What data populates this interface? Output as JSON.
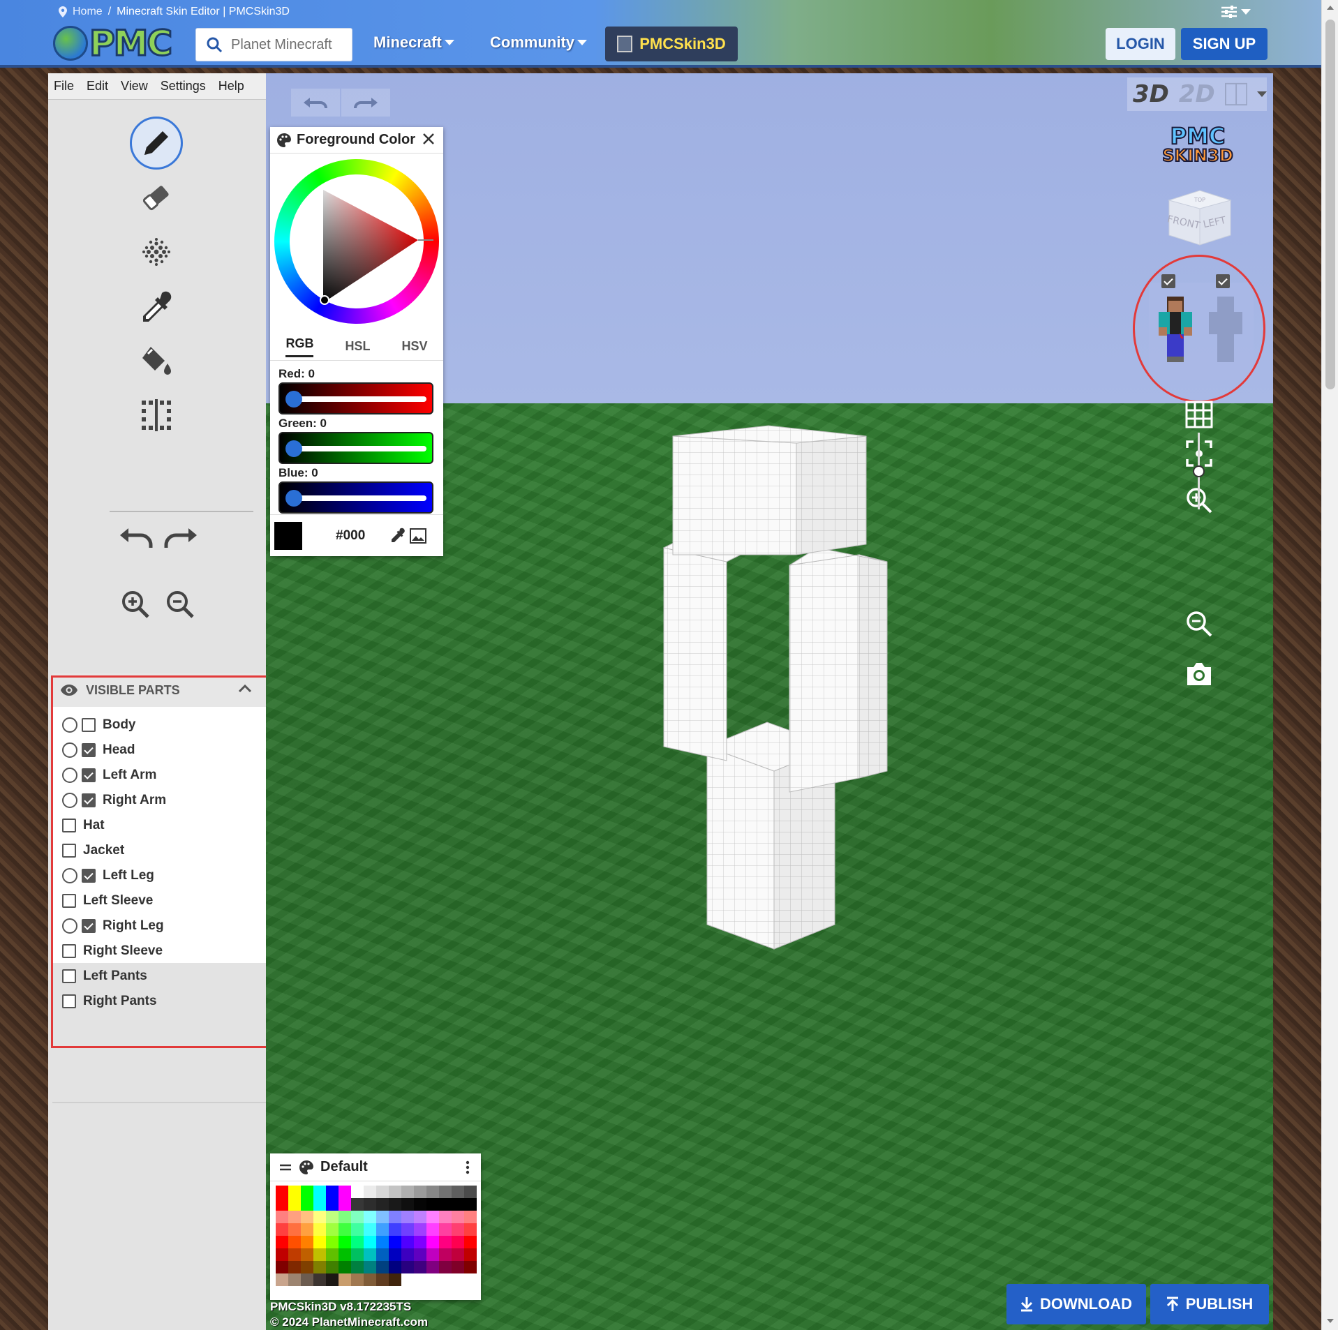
{
  "breadcrumb": {
    "home": "Home",
    "separator": "/",
    "current": "Minecraft Skin Editor | PMCSkin3D"
  },
  "header": {
    "logo_text": "PMC",
    "search_placeholder": "Planet Minecraft",
    "nav": [
      {
        "label": "Minecraft"
      },
      {
        "label": "Community"
      }
    ],
    "app_button": "PMCSkin3D",
    "login": "LOGIN",
    "signup": "SIGN UP"
  },
  "menu": [
    "File",
    "Edit",
    "View",
    "Settings",
    "Help"
  ],
  "tools": [
    "pencil-icon",
    "eraser-icon",
    "noise-icon",
    "eyedropper-icon",
    "bucket-icon",
    "mirror-icon",
    "undo-icon",
    "redo-icon",
    "zoom-in-icon",
    "zoom-out-icon"
  ],
  "visible_parts": {
    "title": "VISIBLE PARTS",
    "items": [
      {
        "label": "Body",
        "radio": true,
        "checked": false
      },
      {
        "label": "Head",
        "radio": true,
        "checked": true
      },
      {
        "label": "Left Arm",
        "radio": true,
        "checked": true
      },
      {
        "label": "Right Arm",
        "radio": true,
        "checked": true
      },
      {
        "label": "Hat",
        "radio": false,
        "checked": false
      },
      {
        "label": "Jacket",
        "radio": false,
        "checked": false
      },
      {
        "label": "Left Leg",
        "radio": true,
        "checked": true
      },
      {
        "label": "Left Sleeve",
        "radio": false,
        "checked": false
      },
      {
        "label": "Right Leg",
        "radio": true,
        "checked": true
      },
      {
        "label": "Right Sleeve",
        "radio": false,
        "checked": false
      },
      {
        "label": "Left Pants",
        "radio": false,
        "checked": false
      },
      {
        "label": "Right Pants",
        "radio": false,
        "checked": false
      }
    ]
  },
  "view_mode": {
    "mode_3d": "3D",
    "mode_2d": "2D"
  },
  "pmc_logo": {
    "line1": "PMC",
    "line2": "SKIN3D"
  },
  "nav_cube": {
    "top": "TOP",
    "front": "FRONT",
    "left": "LEFT"
  },
  "color_picker": {
    "title": "Foreground Color",
    "tabs": [
      "RGB",
      "HSL",
      "HSV"
    ],
    "active_tab": "RGB",
    "red_label": "Red: 0",
    "green_label": "Green: 0",
    "blue_label": "Blue: 0",
    "hex": "#000",
    "current_color": "#000000"
  },
  "palette": {
    "title": "Default",
    "rows": [
      [
        "#ff0000",
        "#ffff00",
        "#00ff00",
        "#00ffff",
        "#0000ff",
        "#ff00ff",
        "#ffffff",
        "#ebebeb",
        "#d7d7d7",
        "#c3c3c3",
        "#afafaf",
        "#9b9b9b",
        "#878787",
        "#737373",
        "#5f5f5f",
        "#4b4b4b"
      ],
      [
        "#ff0000",
        "#ffff00",
        "#00ff00",
        "#00ffff",
        "#0000ff",
        "#ff00ff",
        "#373737",
        "#2d2d2d",
        "#232323",
        "#191919",
        "#0f0f0f",
        "#050505",
        "#000000",
        "#000000",
        "#000000",
        "#000000"
      ],
      [
        "#ff8080",
        "#ffa080",
        "#ffc080",
        "#ffff80",
        "#c0ff80",
        "#80ff80",
        "#80ffc0",
        "#80ffff",
        "#80c0ff",
        "#8080ff",
        "#a080ff",
        "#c080ff",
        "#ff80ff",
        "#ff80c0",
        "#ff80a0",
        "#ff8080"
      ],
      [
        "#ff4040",
        "#ff7040",
        "#ffa040",
        "#ffff40",
        "#a0ff40",
        "#40ff40",
        "#40ffa0",
        "#40ffff",
        "#40a0ff",
        "#4040ff",
        "#7040ff",
        "#a040ff",
        "#ff40ff",
        "#ff40a0",
        "#ff4070",
        "#ff4040"
      ],
      [
        "#ff0000",
        "#ff5000",
        "#ff8000",
        "#ffff00",
        "#80ff00",
        "#00ff00",
        "#00ff80",
        "#00ffff",
        "#0080ff",
        "#0000ff",
        "#5000ff",
        "#8000ff",
        "#ff00ff",
        "#ff0080",
        "#ff0050",
        "#ff0000"
      ],
      [
        "#c00000",
        "#c03c00",
        "#c06000",
        "#c0c000",
        "#60c000",
        "#00c000",
        "#00c060",
        "#00c0c0",
        "#0060c0",
        "#0000c0",
        "#3c00c0",
        "#6000c0",
        "#c000c0",
        "#c00060",
        "#c0003c",
        "#c00000"
      ],
      [
        "#800000",
        "#802800",
        "#804000",
        "#808000",
        "#408000",
        "#008000",
        "#008040",
        "#008080",
        "#004080",
        "#000080",
        "#280080",
        "#400080",
        "#800080",
        "#800040",
        "#800028",
        "#800000"
      ],
      [
        "#c8a48c",
        "#9c8470",
        "#6c5c50",
        "#3c3430",
        "#1c1814",
        "#c89c6c",
        "#a07850",
        "#805c38",
        "#603c20",
        "#40240c",
        "#ffffff",
        "#ffffff",
        "#ffffff",
        "#ffffff",
        "#ffffff",
        "#ffffff"
      ]
    ]
  },
  "version_line1": "PMCSkin3D v8.172235TS",
  "version_line2": "© 2024 PlanetMinecraft.com",
  "actions": {
    "download": "DOWNLOAD",
    "publish": "PUBLISH"
  },
  "colors": {
    "accent": "#2460c8",
    "highlight": "#e23a3a"
  }
}
